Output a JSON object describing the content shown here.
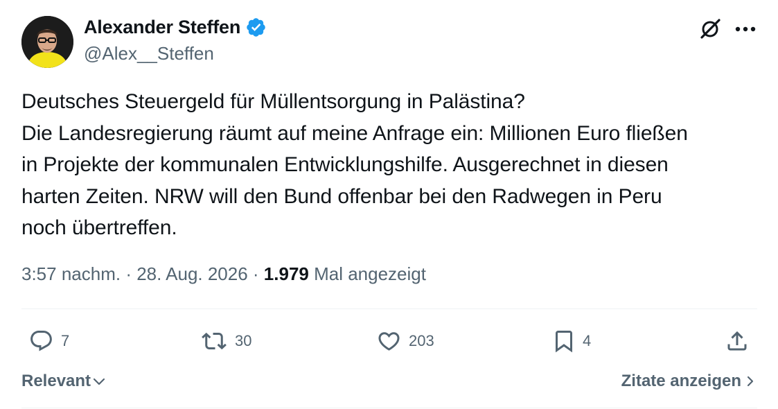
{
  "author": {
    "display_name": "Alexander Steffen",
    "handle": "@Alex__Steffen",
    "verified": true
  },
  "tweet": {
    "lines": [
      "Deutsches Steuergeld für Müllentsorgung in Palästina?",
      "Die Landesregierung räumt auf meine Anfrage ein: Millionen Euro fließen",
      "in Projekte der kommunalen Entwicklungshilfe. Ausgerechnet in diesen",
      "harten Zeiten. NRW will den Bund offenbar bei den Radwegen in Peru",
      "noch übertreffen."
    ]
  },
  "meta": {
    "time": "3:57 nachm.",
    "separator": " · ",
    "date": "28. Aug. 2026",
    "views": "1.979",
    "views_label": " Mal angezeigt"
  },
  "actions": {
    "replies": "7",
    "reposts": "30",
    "likes": "203",
    "bookmarks": "4"
  },
  "footer": {
    "sort_label": "Relevant",
    "quotes_label": "Zitate anzeigen"
  },
  "colors": {
    "text_primary": "#0f1419",
    "text_secondary": "#536471",
    "verified_blue": "#1d9bf0",
    "divider": "#eff3f4"
  }
}
